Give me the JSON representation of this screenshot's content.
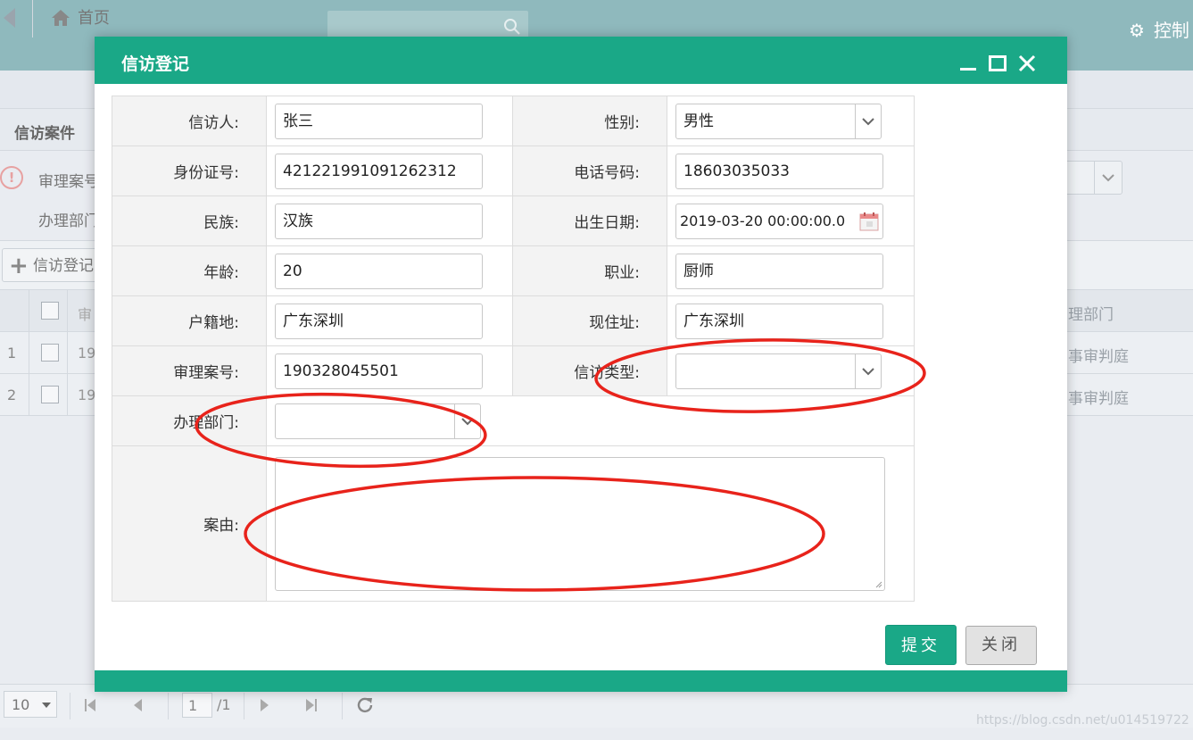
{
  "topbar": {
    "control_label": "控制"
  },
  "tabs": {
    "home_label": "首页"
  },
  "panel": {
    "title": "信访案件"
  },
  "filters": {
    "case_no_label": "审理案号",
    "dept_label": "办理部门"
  },
  "toolbar": {
    "add_label": "信访登记"
  },
  "grid": {
    "col_case": "审",
    "col_dept": "理部门",
    "rows": [
      {
        "num": "1",
        "code": "19",
        "dept": "事审判庭"
      },
      {
        "num": "2",
        "code": "19",
        "dept": "事审判庭"
      }
    ]
  },
  "pager": {
    "page_size": "10",
    "page": "1",
    "total": "/1"
  },
  "watermark": "https://blog.csdn.net/u014519722",
  "dialog": {
    "title": "信访登记",
    "fields": {
      "visitor": {
        "label": "信访人:",
        "value": "张三"
      },
      "gender": {
        "label": "性别:",
        "value": "男性"
      },
      "id_no": {
        "label": "身份证号:",
        "value": "421221991091262312"
      },
      "phone": {
        "label": "电话号码:",
        "value": "18603035033"
      },
      "ethnicity": {
        "label": "民族:",
        "value": "汉族"
      },
      "birthdate": {
        "label": "出生日期:",
        "value": "2019-03-20 00:00:00.0"
      },
      "age": {
        "label": "年龄:",
        "value": "20"
      },
      "occupation": {
        "label": "职业:",
        "value": "厨师"
      },
      "domicile": {
        "label": "户籍地:",
        "value": "广东深圳"
      },
      "address": {
        "label": "现住址:",
        "value": "广东深圳"
      },
      "case_no": {
        "label": "审理案号:",
        "value": "190328045501"
      },
      "visit_type": {
        "label": "信访类型:",
        "value": ""
      },
      "dept": {
        "label": "办理部门:",
        "value": ""
      },
      "reason": {
        "label": "案由:",
        "value": ""
      }
    },
    "buttons": {
      "submit": "提交",
      "close": "关闭"
    }
  },
  "colors": {
    "accent": "#1aa887",
    "annotation": "#e8231b"
  }
}
